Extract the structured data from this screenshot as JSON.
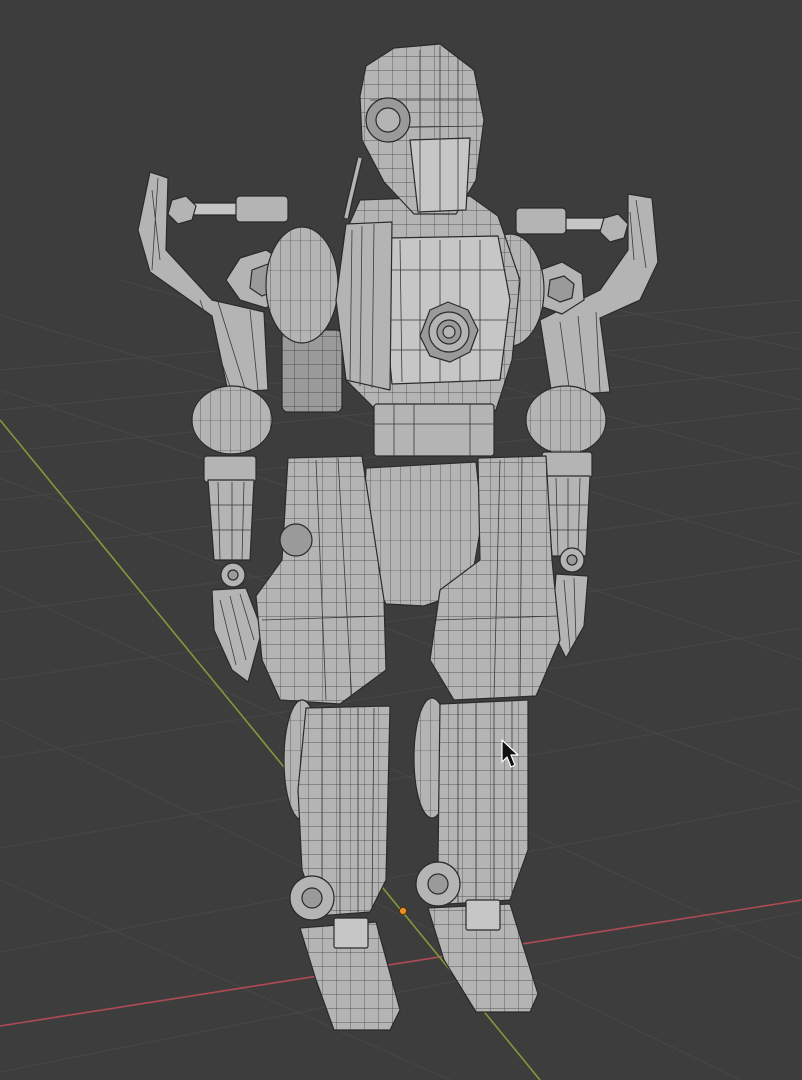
{
  "viewport": {
    "background_color": "#3d3d3d",
    "grid_line_color": "#474747",
    "x_axis_color": "#b04a55",
    "y_axis_color": "#7f9a3a",
    "mesh_color": "#b4b4b4",
    "wire_color": "#2a2a2a",
    "origin_color": "#e8902a"
  },
  "scene": {
    "object_type": "robot-mesh",
    "display": "wireframe-overlay",
    "cursor": "arrow-pointer"
  }
}
